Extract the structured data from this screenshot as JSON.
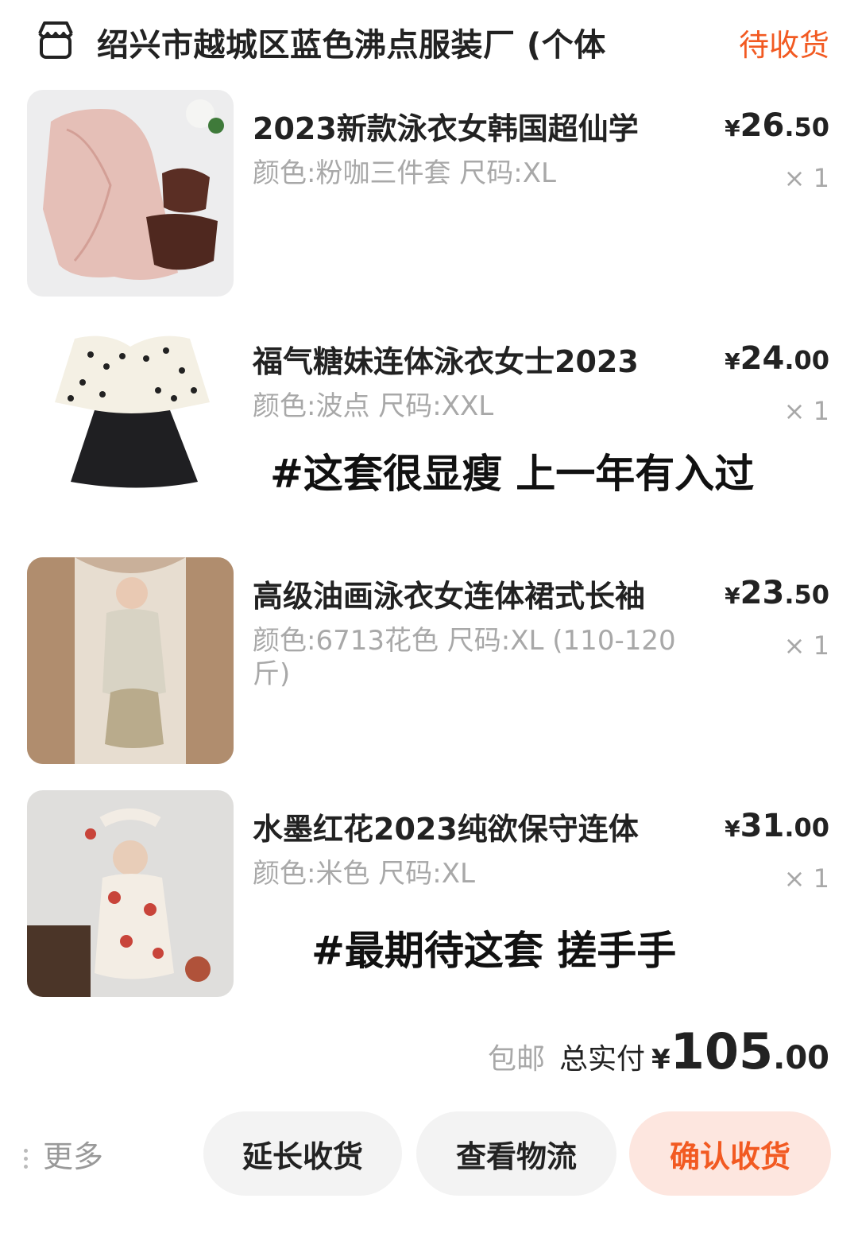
{
  "header": {
    "store_name": "绍兴市越城区蓝色沸点服装厂 (个体",
    "status": "待收货"
  },
  "items": [
    {
      "title": "2023新款泳衣女韩国超仙学",
      "spec": "颜色:粉咖三件套 尺码:XL",
      "price_yen": "¥",
      "price_int": "26",
      "price_dec": ".50",
      "qty": "× 1"
    },
    {
      "title": "福气糖妹连体泳衣女士2023",
      "spec": "颜色:波点 尺码:XXL",
      "price_yen": "¥",
      "price_int": "24",
      "price_dec": ".00",
      "qty": "× 1"
    },
    {
      "title": "高级油画泳衣女连体裙式长袖",
      "spec": "颜色:6713花色 尺码:XL (110-120斤)",
      "price_yen": "¥",
      "price_int": "23",
      "price_dec": ".50",
      "qty": "× 1"
    },
    {
      "title": "水墨红花2023纯欲保守连体",
      "spec": "颜色:米色 尺码:XL",
      "price_yen": "¥",
      "price_int": "31",
      "price_dec": ".00",
      "qty": "× 1"
    }
  ],
  "notes": {
    "item2": "#这套很显瘦 上一年有入过",
    "item4": "#最期待这套 搓手手"
  },
  "total": {
    "free_shipping": "包邮",
    "label": "总实付",
    "yen": "¥",
    "int": "105",
    "dec": ".00"
  },
  "actions": {
    "more": "更多",
    "extend": "延长收货",
    "logistics": "查看物流",
    "confirm": "确认收货"
  },
  "colors": {
    "accent": "#f25a22",
    "confirm_bg": "#fde6df",
    "button_bg": "#f3f3f3",
    "muted_text": "#a8a8a8"
  },
  "icons": {
    "store": "store-icon",
    "more": "vertical-dots-icon"
  }
}
